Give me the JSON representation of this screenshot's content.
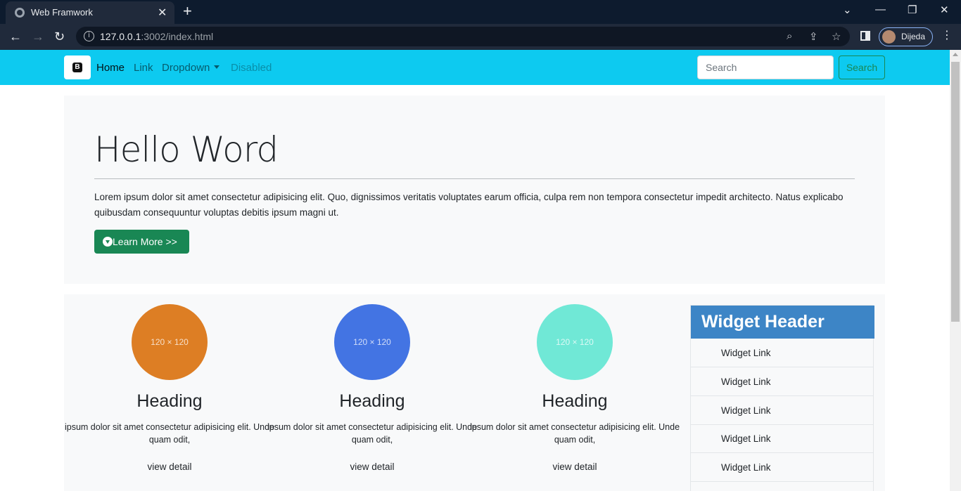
{
  "browser": {
    "tab_title": "Web Framwork",
    "url_host": "127.0.0.1",
    "url_rest": ":3002/index.html",
    "profile_name": "Dijeda",
    "info_icon": "info-icon",
    "icons": [
      "globe-icon",
      "close-icon",
      "plus-icon",
      "back-icon",
      "forward-icon",
      "reload-icon",
      "zoom-icon",
      "share-icon",
      "star-icon",
      "side-panel-icon",
      "menu-icon"
    ]
  },
  "navbar": {
    "brand_letter": "B",
    "links": [
      "Home",
      "Link",
      "Dropdown",
      "Disabled"
    ],
    "search_placeholder": "Search",
    "search_button": "Search",
    "bg_color": "#0dcaf0"
  },
  "jumbotron": {
    "title": "Hello Word",
    "text": "Lorem ipsum dolor sit amet consectetur adipisicing elit. Quo, dignissimos veritatis voluptates earum officia, culpa rem non tempora consectetur impedit architecto. Natus explicabo quibusdam consequuntur voluptas debitis ipsum magni ut.",
    "button_label": "Learn More >>",
    "button_color": "#198754"
  },
  "columns": [
    {
      "placeholder": "120 × 120",
      "color": "#dd7e24",
      "heading": "Heading",
      "text": "ipsum dolor sit amet consectetur adipisicing elit. Unde quam odit,",
      "link": "view detail"
    },
    {
      "placeholder": "120 × 120",
      "color": "#4374e3",
      "heading": "Heading",
      "text": "ipsum dolor sit amet consectetur adipisicing elit. Unde quam odit,",
      "link": "view detail"
    },
    {
      "placeholder": "120 × 120",
      "color": "#70e8d6",
      "heading": "Heading",
      "text": "ipsum dolor sit amet consectetur adipisicing elit. Unde quam odit,",
      "link": "view detail"
    }
  ],
  "widget": {
    "header": "Widget Header",
    "header_color": "#3d85c6",
    "links": [
      "Widget Link",
      "Widget Link",
      "Widget Link",
      "Widget Link",
      "Widget Link"
    ]
  }
}
